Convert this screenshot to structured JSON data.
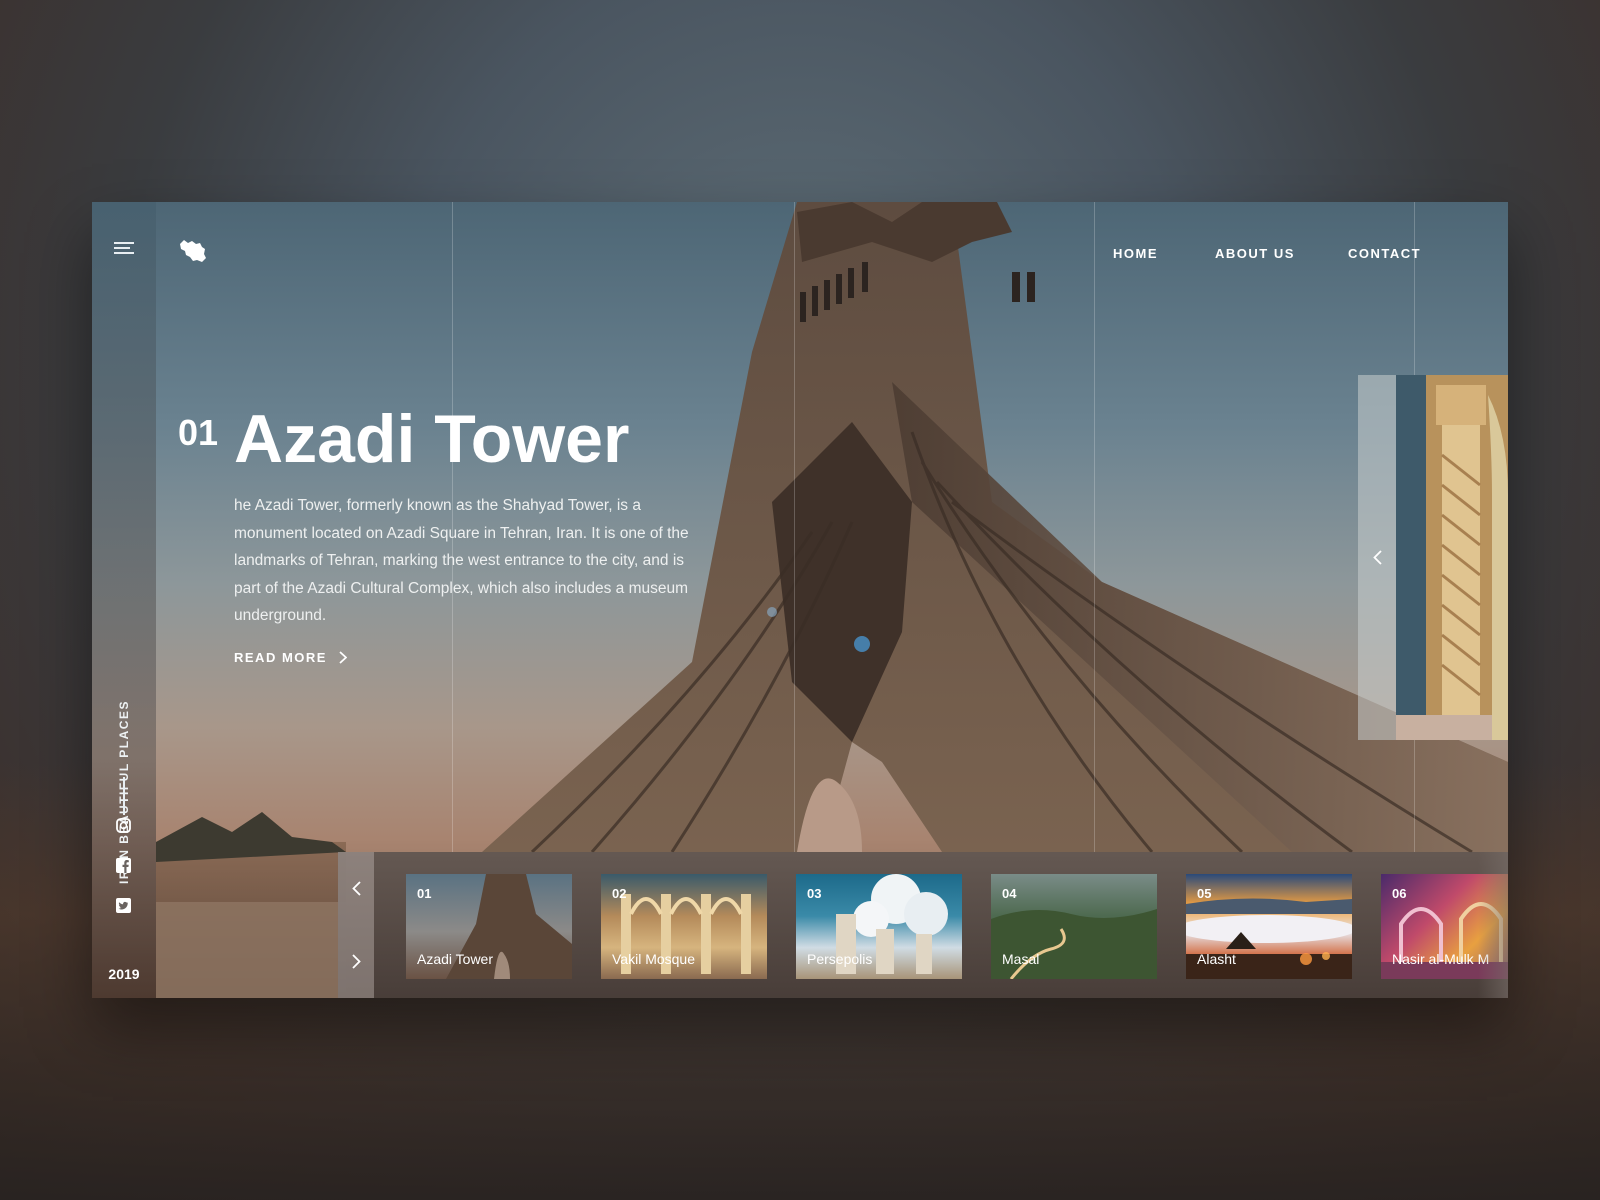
{
  "brand": {
    "logo_icon": "iran-map-icon"
  },
  "sidebar": {
    "menu_icon": "hamburger-menu-icon",
    "vertical_title": "IRAN BEAUTIFUL PLACES",
    "social": [
      {
        "icon": "instagram-icon"
      },
      {
        "icon": "facebook-icon"
      },
      {
        "icon": "twitter-icon"
      }
    ],
    "year": "2019"
  },
  "nav": {
    "items": [
      {
        "label": "HOME"
      },
      {
        "label": "ABOUT US"
      },
      {
        "label": "CONTACT"
      }
    ]
  },
  "hero": {
    "number": "01",
    "title": "Azadi Tower",
    "description": "he Azadi Tower, formerly known as the Shahyad Tower, is a monument located on Azadi Square in Tehran, Iran. It is one of the landmarks of Tehran, marking the west entrance to the city, and is part of the Azadi Cultural Complex, which also includes a museum underground.",
    "read_more": "READ MORE"
  },
  "side_preview": {
    "arrow_icon": "chevron-left-icon"
  },
  "gallery": {
    "prev_icon": "chevron-left-icon",
    "next_icon": "chevron-right-icon",
    "items": [
      {
        "number": "01",
        "name": "Azadi Tower"
      },
      {
        "number": "02",
        "name": "Vakil Mosque"
      },
      {
        "number": "03",
        "name": "Persepolis"
      },
      {
        "number": "04",
        "name": "Masal"
      },
      {
        "number": "05",
        "name": "Alasht"
      },
      {
        "number": "06",
        "name": "Nasir al-Mulk M"
      }
    ]
  },
  "colors": {
    "text": "#ffffff",
    "sky_top": "#4d6675",
    "tower": "#6e5746"
  }
}
